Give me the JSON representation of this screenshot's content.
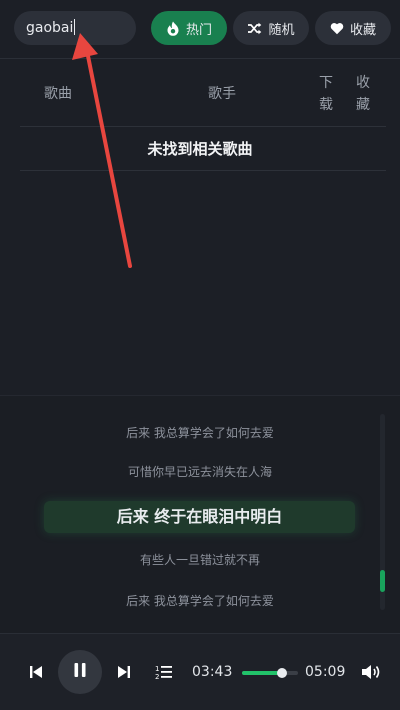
{
  "search": {
    "value": "gaobai",
    "placeholder": ""
  },
  "nav": {
    "hot_label": "热门",
    "random_label": "随机",
    "favorites_label": "收藏"
  },
  "table": {
    "columns": [
      "歌曲",
      "歌手",
      "下载",
      "收藏"
    ],
    "col_download_chars": [
      "下",
      "载"
    ],
    "col_fav_chars": [
      "收",
      "藏"
    ],
    "empty_message": "未找到相关歌曲"
  },
  "lyrics": {
    "lines": [
      "后来 我总算学会了如何去爱",
      "可惜你早已远去消失在人海",
      "后来 终于在眼泪中明白",
      "有些人一旦错过就不再",
      "后来 我总算学会了如何去爱"
    ],
    "current_index": 2
  },
  "player": {
    "current_time": "03:43",
    "total_time": "05:09",
    "progress_fraction": 0.72
  },
  "colors": {
    "accent": "#19804f",
    "progress": "#22c26a",
    "background": "#1c1f26",
    "annotation_arrow": "#e8463f"
  },
  "icons": {
    "hot": "flame-icon",
    "random": "shuffle-icon",
    "favorites": "heart-icon",
    "prev": "skip-previous-icon",
    "play_pause": "pause-icon",
    "next": "skip-next-icon",
    "playlist": "playlist-icon",
    "volume": "volume-icon"
  }
}
